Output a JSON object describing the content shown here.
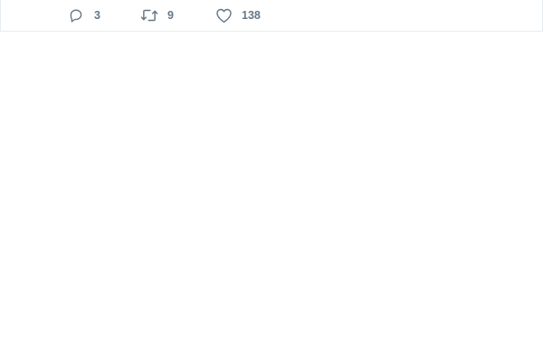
{
  "tweet": {
    "actions": {
      "reply": {
        "icon": "reply-icon",
        "count": "3"
      },
      "retweet": {
        "icon": "retweet-icon",
        "count": "9"
      },
      "like": {
        "icon": "heart-icon",
        "count": "138"
      }
    }
  },
  "colors": {
    "action_text": "#657786",
    "border": "#e6ecf0",
    "background": "#ffffff"
  }
}
